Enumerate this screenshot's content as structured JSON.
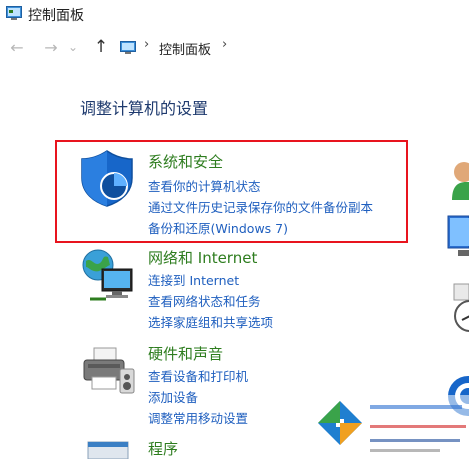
{
  "window": {
    "title": "控制面板"
  },
  "nav": {
    "back_glyph": "←",
    "forward_glyph": "→",
    "dropdown_glyph": "⌄",
    "up_glyph": "↑",
    "separator": "›",
    "breadcrumb": "控制面板"
  },
  "page": {
    "title": "调整计算机的设置"
  },
  "categories": [
    {
      "title": "系统和安全",
      "icon": "shield-icon",
      "links": [
        "查看你的计算机状态",
        "通过文件历史记录保存你的文件备份副本",
        "备份和还原(Windows 7)"
      ]
    },
    {
      "title": "网络和 Internet",
      "icon": "network-icon",
      "links": [
        "连接到 Internet",
        "查看网络状态和任务",
        "选择家庭组和共享选项"
      ]
    },
    {
      "title": "硬件和声音",
      "icon": "printer-icon",
      "links": [
        "查看设备和打印机",
        "添加设备",
        "调整常用移动设置"
      ]
    },
    {
      "title": "程序",
      "icon": "programs-icon",
      "links": []
    }
  ],
  "right_column_icons": [
    "user-accounts-icon",
    "appearance-icon",
    "clock-icon",
    "ease-of-access-icon"
  ],
  "colors": {
    "category_title": "#2e7d1f",
    "link": "#1f5fbf",
    "highlight": "#e8141e",
    "page_title": "#1e3a6e"
  }
}
